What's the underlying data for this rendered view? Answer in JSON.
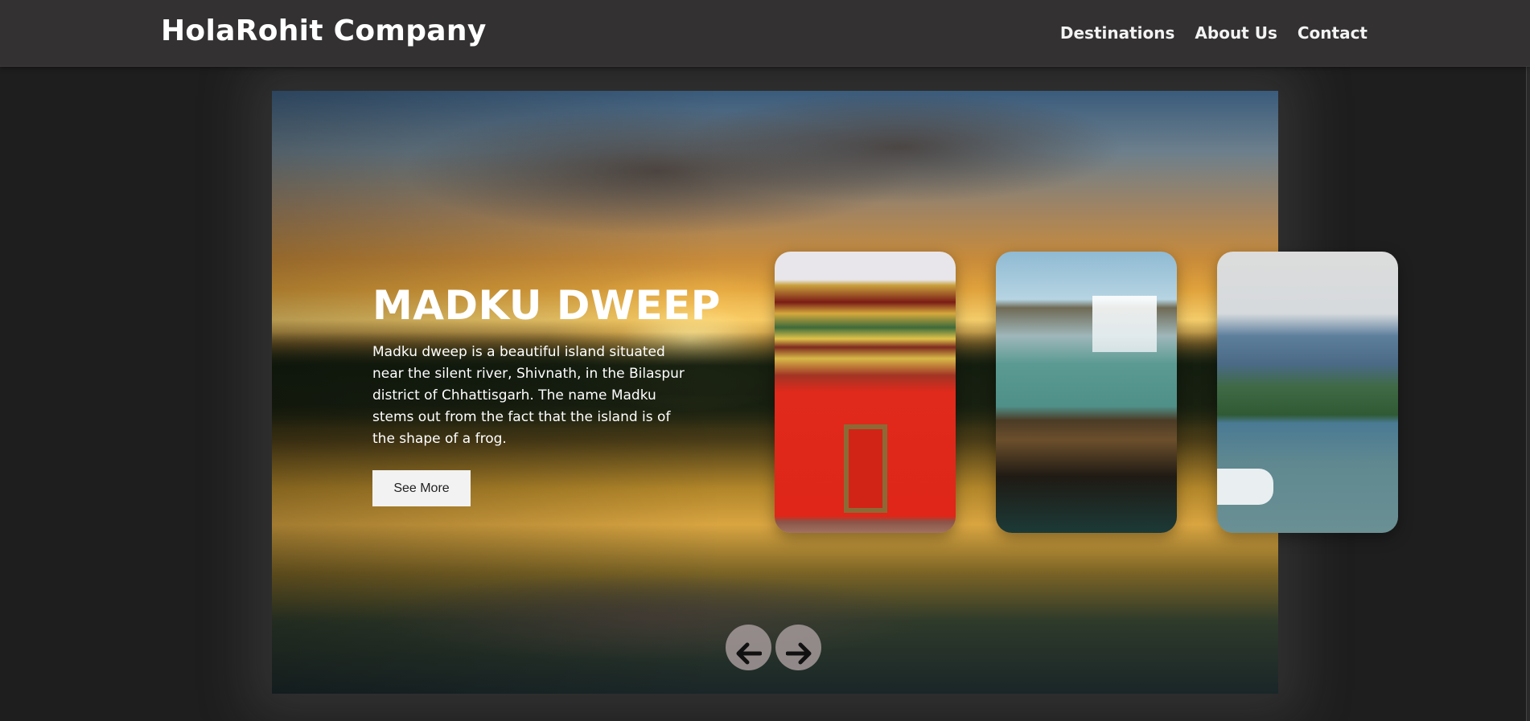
{
  "navbar": {
    "brand": "HolaRohit Company",
    "links": [
      {
        "label": "Destinations"
      },
      {
        "label": "About Us"
      },
      {
        "label": "Contact"
      }
    ]
  },
  "hero": {
    "title": "MADKU DWEEP",
    "description": "Madku dweep is a beautiful island situated near the silent river, Shivnath, in the Bilaspur district of Chhattisgarh. The name Madku stems out from the fact that the island is of the shape of a frog.",
    "cta_label": "See More"
  },
  "carousel": {
    "cards": [
      {
        "icon": "monastery-image"
      },
      {
        "icon": "waterfall-boat-image"
      },
      {
        "icon": "lake-speedboat-image"
      }
    ],
    "prev_icon": "arrow-left-icon",
    "next_icon": "arrow-right-icon"
  },
  "colors": {
    "navbar_bg": "#333132",
    "page_bg": "#1e1e1e",
    "button_bg": "#f2f2f2",
    "arrow_bg": "#a09696"
  }
}
